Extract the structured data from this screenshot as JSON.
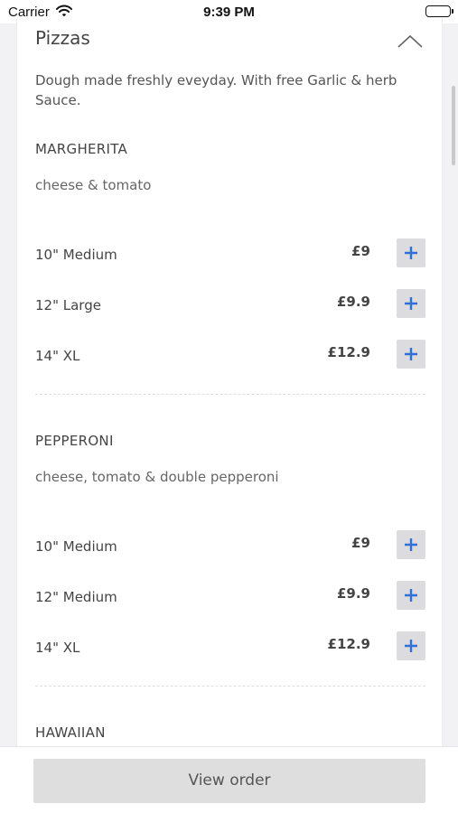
{
  "status_bar": {
    "carrier": "Carrier",
    "time": "9:39 PM"
  },
  "section": {
    "title": "Pizzas",
    "description": "Dough made freshly eveyday. With free Garlic & herb Sauce.",
    "collapse_icon": "chevron-up-icon"
  },
  "items": [
    {
      "name": "MARGHERITA",
      "description": "cheese & tomato",
      "variants": [
        {
          "size": "10\" Medium",
          "price": "£9"
        },
        {
          "size": "12\" Large",
          "price": "£9.9"
        },
        {
          "size": "14\" XL",
          "price": "£12.9"
        }
      ]
    },
    {
      "name": "PEPPERONI",
      "description": "cheese, tomato & double pepperoni",
      "variants": [
        {
          "size": "10\" Medium",
          "price": "£9"
        },
        {
          "size": "12\" Medium",
          "price": "£9.9"
        },
        {
          "size": "14\" XL",
          "price": "£12.9"
        }
      ]
    },
    {
      "name": "HAWAIIAN"
    }
  ],
  "bottom_bar": {
    "view_order_label": "View order"
  },
  "colors": {
    "accent": "#2f6fd6",
    "button_bg": "#dcdcde"
  }
}
